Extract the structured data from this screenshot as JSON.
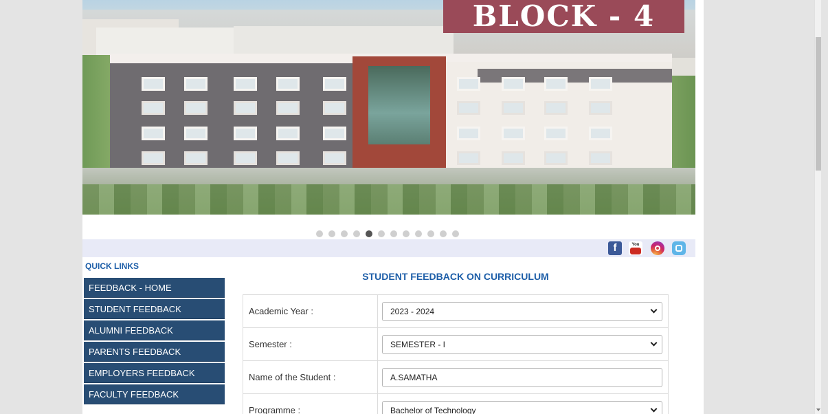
{
  "banner": {
    "label": "BLOCK - 4"
  },
  "slider": {
    "dots": 12,
    "active": 5
  },
  "social": {
    "icons": [
      "facebook-icon",
      "youtube-icon",
      "instagram-icon",
      "twitter-icon"
    ],
    "fb_glyph": "f",
    "yt_text": "You"
  },
  "quick_links": {
    "title": "QUICK LINKS",
    "items": [
      "FEEDBACK - HOME",
      "STUDENT FEEDBACK",
      "ALUMNI FEEDBACK",
      "PARENTS FEEDBACK",
      "EMPLOYERS FEEDBACK",
      "FACULTY FEEDBACK"
    ]
  },
  "form": {
    "title": "STUDENT FEEDBACK ON CURRICULUM",
    "fields": [
      {
        "label": "Academic Year :",
        "value": "2023 - 2024",
        "type": "select"
      },
      {
        "label": "Semester :",
        "value": "SEMESTER - I",
        "type": "select"
      },
      {
        "label": "Name of the Student :",
        "value": "A.SAMATHA",
        "type": "input"
      },
      {
        "label": "Programme :",
        "value": "Bachelor of Technology",
        "type": "select"
      }
    ]
  },
  "colors": {
    "nav_bg": "#284d74",
    "title_blue": "#1d5ea8",
    "banner_label_bg": "#9a4a58",
    "social_bar_bg": "#e8eaf7"
  }
}
